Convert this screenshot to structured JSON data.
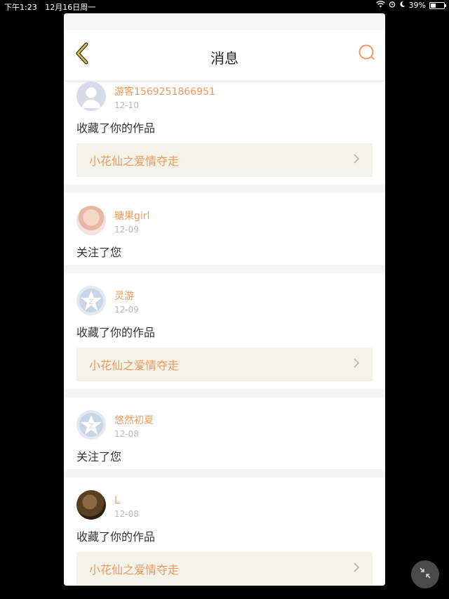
{
  "status_bar": {
    "time": "下午1:23",
    "date": "12月16日周一",
    "battery": "39%",
    "battery_level": 0.39
  },
  "nav": {
    "title": "消息",
    "back_icon": "chevron-left-icon",
    "search_icon": "search-icon"
  },
  "messages": [
    {
      "username": "游客1569251866951",
      "date": "12-10",
      "action": "收藏了你的作品",
      "work_title": "小花仙之爱情夺走",
      "avatar": "default-avatar"
    },
    {
      "username": "糖果girl",
      "date": "12-09",
      "action": "关注了您",
      "avatar": "photo-avatar"
    },
    {
      "username": "灵游",
      "date": "12-09",
      "action": "收藏了你的作品",
      "work_title": "小花仙之爱情夺走",
      "avatar": "qq-avatar"
    },
    {
      "username": "悠然初夏",
      "date": "12-08",
      "action": "关注了您",
      "avatar": "qq-avatar"
    },
    {
      "username": "L",
      "date": "12-08",
      "action": "收藏了你的作品",
      "work_title": "小花仙之爱情夺走",
      "avatar": "photo-avatar"
    }
  ],
  "colors": {
    "accent": "#f0995e",
    "work_bg": "#f4f3ea",
    "back_arrow": "#c9a93a"
  },
  "floating_button_icon": "collapse-arrows-icon"
}
